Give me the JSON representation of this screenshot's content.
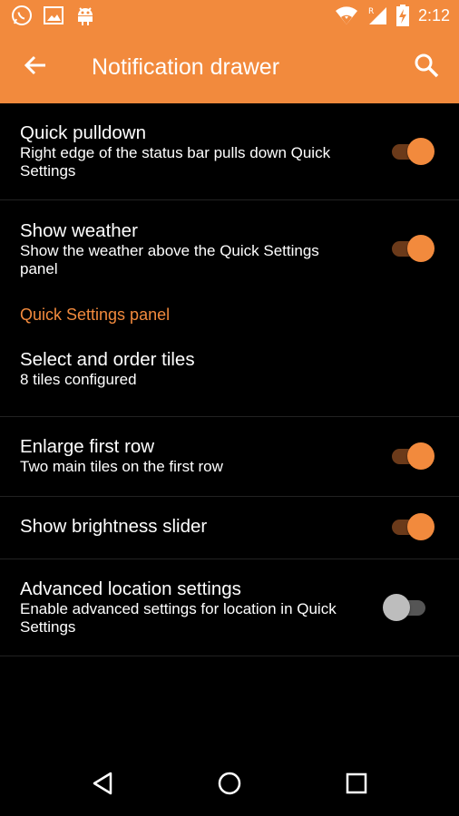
{
  "colors": {
    "accent": "#f28a3d",
    "background": "#000000",
    "switch_on_track": "#6b3a1a",
    "switch_off_thumb": "#bdbdbd"
  },
  "status_bar": {
    "time": "2:12",
    "left_icons": [
      "whatsapp-icon",
      "image-icon",
      "android-debug-icon"
    ],
    "right_icons": [
      "wifi-icon",
      "roaming-signal-icon",
      "battery-charging-icon"
    ]
  },
  "toolbar": {
    "title": "Notification drawer",
    "back_icon": "arrow-left-icon",
    "search_icon": "search-icon"
  },
  "preferences": [
    {
      "title": "Quick pulldown",
      "summary": "Right edge of the status bar pulls down Quick Settings",
      "switch": true
    },
    {
      "title": "Show weather",
      "summary": "Show the weather above the Quick Settings panel",
      "switch": true
    }
  ],
  "category": {
    "title": "Quick Settings panel"
  },
  "panel_preferences": [
    {
      "title": "Select and order tiles",
      "summary": "8 tiles configured"
    },
    {
      "title": "Enlarge first row",
      "summary": "Two main tiles on the first row",
      "switch": true
    },
    {
      "title": "Show brightness slider",
      "switch": true
    },
    {
      "title": "Advanced location settings",
      "summary": "Enable advanced settings for location in Quick Settings",
      "switch": false
    }
  ],
  "nav_bar": {
    "icons": [
      "back-triangle-icon",
      "home-circle-icon",
      "recents-square-icon"
    ]
  }
}
